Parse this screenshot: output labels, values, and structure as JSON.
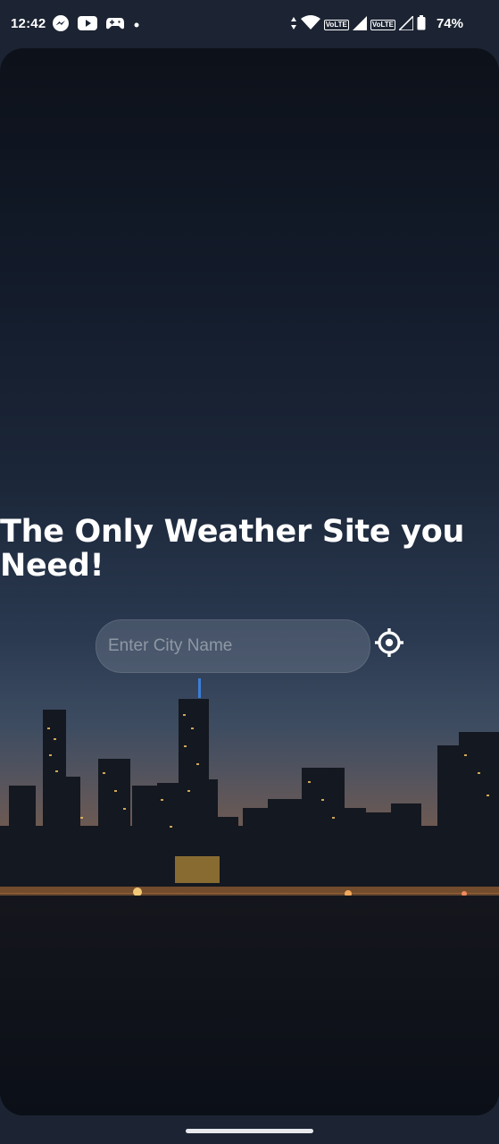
{
  "status_bar": {
    "time": "12:42",
    "battery_percent": "74%",
    "notification_icons": [
      "messenger-icon",
      "youtube-icon",
      "game-controller-icon",
      "dot-icon"
    ],
    "system_icons": [
      "data-arrows-icon",
      "wifi-icon",
      "volte-icon",
      "signal-icon",
      "volte-icon",
      "signal-icon",
      "battery-icon"
    ],
    "volte_label": "VoLTE"
  },
  "main": {
    "headline": "The Only Weather Site you Need!",
    "search": {
      "placeholder": "Enter City Name",
      "value": ""
    },
    "locate_icon": "crosshair-icon"
  },
  "colors": {
    "status_bar_bg": "#1c2433",
    "text": "#ffffff",
    "input_bg": "rgba(140,150,165,0.30)"
  }
}
